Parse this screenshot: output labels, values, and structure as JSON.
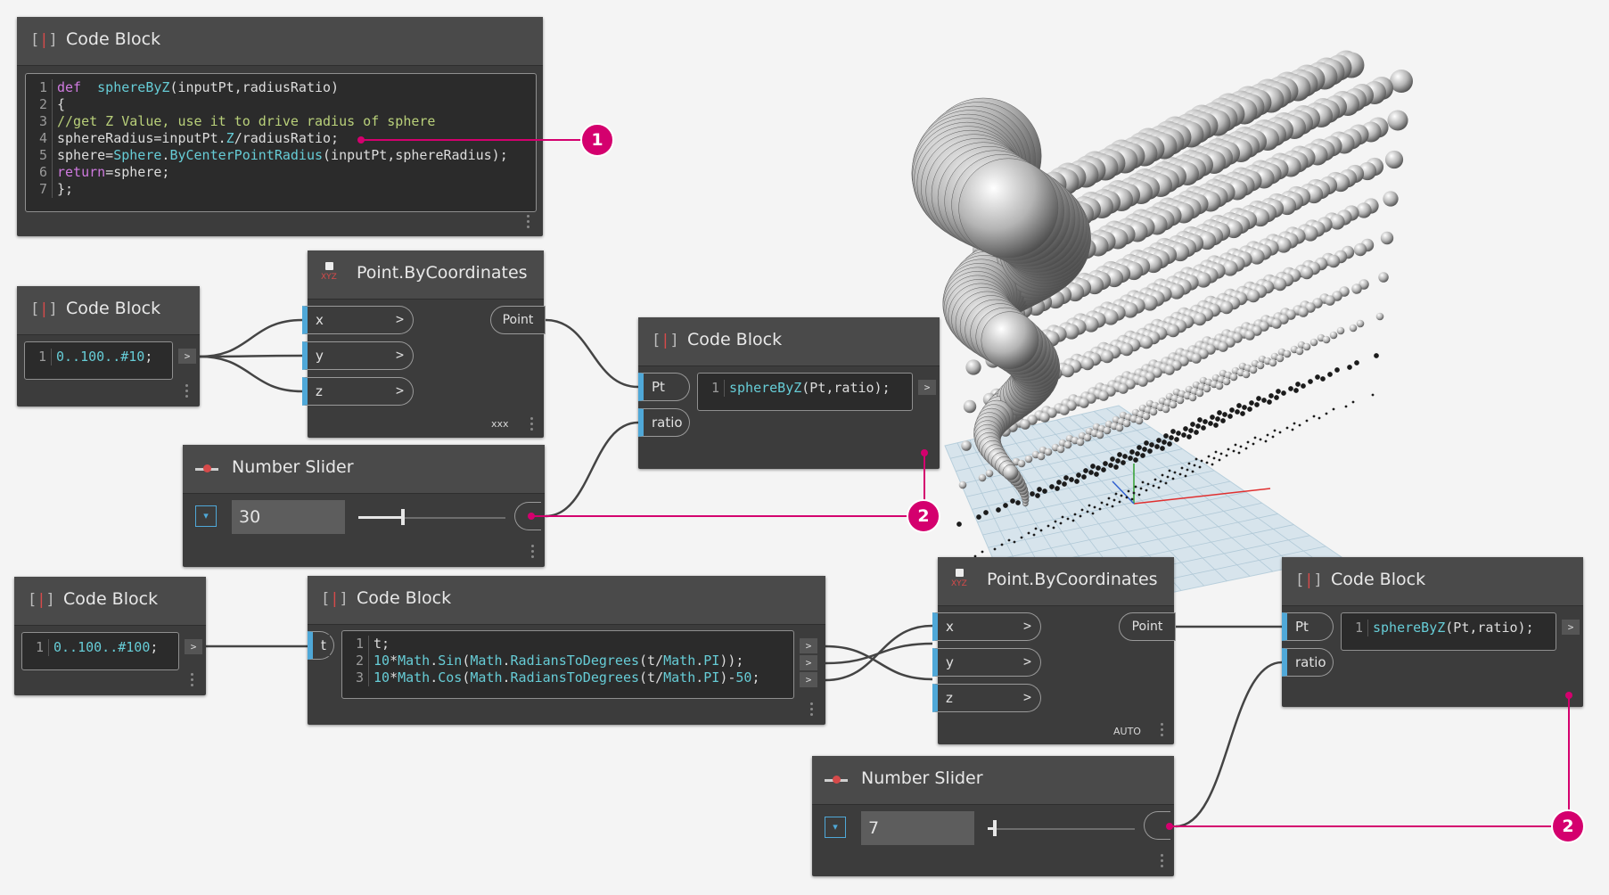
{
  "colors": {
    "callout": "#d4006e",
    "port_accent": "#4fa8d8",
    "node_bg": "#3c3c3c",
    "header_bg": "#4a4a4a",
    "icon_red": "#d64a4a"
  },
  "nodes": {
    "cb_sphere": {
      "title": "Code Block",
      "lines": [
        {
          "n": "1",
          "segs": [
            [
              "kw",
              "def"
            ],
            [
              "",
              "  "
            ],
            [
              "fn",
              "sphereByZ"
            ],
            [
              "",
              "(inputPt,radiusRatio)"
            ]
          ]
        },
        {
          "n": "2",
          "segs": [
            [
              "",
              "{"
            ]
          ]
        },
        {
          "n": "3",
          "segs": [
            [
              "cm",
              "//get Z Value, use it to drive radius of sphere"
            ]
          ]
        },
        {
          "n": "4",
          "segs": [
            [
              "",
              "sphereRadius=inputPt."
            ],
            [
              "mth",
              "Z"
            ],
            [
              "",
              "/radiusRatio;"
            ]
          ]
        },
        {
          "n": "5",
          "segs": [
            [
              "",
              "sphere="
            ],
            [
              "fn",
              "Sphere"
            ],
            [
              "",
              "."
            ],
            [
              "fn",
              "ByCenterPointRadius"
            ],
            [
              "",
              "(inputPt,sphereRadius);"
            ]
          ]
        },
        {
          "n": "6",
          "segs": [
            [
              "kw",
              "return"
            ],
            [
              "",
              "=sphere;"
            ]
          ]
        },
        {
          "n": "7",
          "segs": [
            [
              "",
              "};"
            ]
          ]
        }
      ]
    },
    "cb_range1": {
      "title": "Code Block",
      "lines": [
        {
          "n": "1",
          "segs": [
            [
              "num",
              "0..100..#10"
            ],
            [
              "",
              ";"
            ]
          ]
        }
      ],
      "out": ">"
    },
    "pbc1": {
      "title": "Point.ByCoordinates",
      "inputs": [
        "x",
        "y",
        "z"
      ],
      "chev": ">",
      "output": "Point",
      "lacing": "xxx"
    },
    "cb_call1": {
      "title": "Code Block",
      "inputs": [
        "Pt",
        "ratio"
      ],
      "lines": [
        {
          "n": "1",
          "segs": [
            [
              "fn",
              "sphereByZ"
            ],
            [
              "",
              "(Pt,ratio);"
            ]
          ]
        }
      ],
      "out": ">"
    },
    "slider1": {
      "title": "Number Slider",
      "value": "30",
      "fraction": 0.3,
      "dropdown": "▾"
    },
    "cb_range2": {
      "title": "Code Block",
      "lines": [
        {
          "n": "1",
          "segs": [
            [
              "num",
              "0..100..#100"
            ],
            [
              "",
              ";"
            ]
          ]
        }
      ],
      "out": ">"
    },
    "cb_helix": {
      "title": "Code Block",
      "inputs": [
        "t"
      ],
      "lines": [
        {
          "n": "1",
          "segs": [
            [
              "",
              "t;"
            ]
          ]
        },
        {
          "n": "2",
          "segs": [
            [
              "num",
              "10"
            ],
            [
              "",
              "*"
            ],
            [
              "mth",
              "Math"
            ],
            [
              "",
              "."
            ],
            [
              "fn",
              "Sin"
            ],
            [
              "",
              "("
            ],
            [
              "mth",
              "Math"
            ],
            [
              "",
              "."
            ],
            [
              "fn",
              "RadiansToDegrees"
            ],
            [
              "",
              "(t/"
            ],
            [
              "mth",
              "Math"
            ],
            [
              "",
              "."
            ],
            [
              "fn",
              "PI"
            ],
            [
              "",
              "));"
            ]
          ]
        },
        {
          "n": "3",
          "segs": [
            [
              "num",
              "10"
            ],
            [
              "",
              "*"
            ],
            [
              "mth",
              "Math"
            ],
            [
              "",
              "."
            ],
            [
              "fn",
              "Cos"
            ],
            [
              "",
              "("
            ],
            [
              "mth",
              "Math"
            ],
            [
              "",
              "."
            ],
            [
              "fn",
              "RadiansToDegrees"
            ],
            [
              "",
              "(t/"
            ],
            [
              "mth",
              "Math"
            ],
            [
              "",
              "."
            ],
            [
              "fn",
              "PI"
            ],
            [
              "",
              ")-"
            ],
            [
              "num",
              "50"
            ],
            [
              "",
              ";"
            ]
          ]
        }
      ],
      "outs": [
        ">",
        ">",
        ">"
      ]
    },
    "pbc2": {
      "title": "Point.ByCoordinates",
      "inputs": [
        "x",
        "y",
        "z"
      ],
      "chev": ">",
      "output": "Point",
      "lacing": "AUTO"
    },
    "cb_call2": {
      "title": "Code Block",
      "inputs": [
        "Pt",
        "ratio"
      ],
      "lines": [
        {
          "n": "1",
          "segs": [
            [
              "fn",
              "sphereByZ"
            ],
            [
              "",
              "(Pt,ratio);"
            ]
          ]
        }
      ],
      "out": ">"
    },
    "slider2": {
      "title": "Number Slider",
      "value": "7",
      "fraction": 0.05,
      "dropdown": "▾"
    }
  },
  "callouts": [
    "1",
    "2",
    "2"
  ],
  "icons": {
    "code_block": "code-block-icon",
    "point": "point-by-coordinates-icon",
    "slider": "number-slider-icon"
  }
}
